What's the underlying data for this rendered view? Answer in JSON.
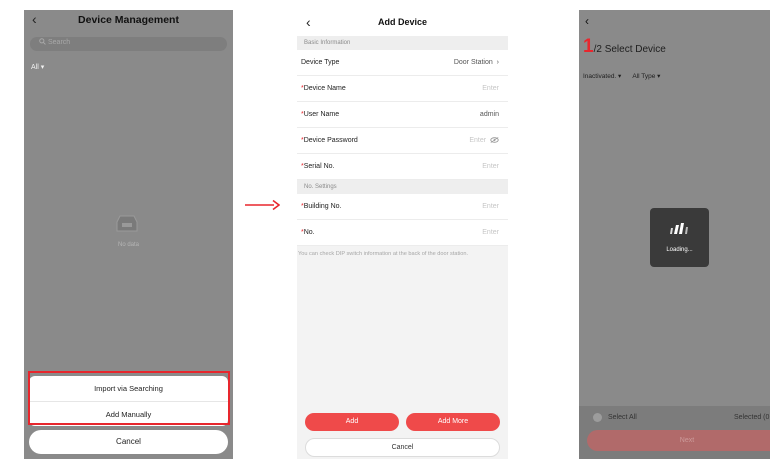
{
  "panel1": {
    "title": "Device Management",
    "search_placeholder": "Search",
    "filter": "All ▾",
    "empty_text": "No data",
    "sheet": {
      "option1": "Import via Searching",
      "option2": "Add Manually",
      "cancel": "Cancel"
    }
  },
  "panel2": {
    "title": "Add Device",
    "basic_section": "Basic Information",
    "rows": {
      "device_type": {
        "label": "Device Type",
        "value": "Door Station"
      },
      "device_name": {
        "label": "Device Name",
        "value": "Enter"
      },
      "user_name": {
        "label": "User Name",
        "value": "admin"
      },
      "device_password": {
        "label": "Device Password",
        "value": "Enter"
      },
      "serial_no": {
        "label": "Serial No.",
        "value": "Enter"
      },
      "building_no": {
        "label": "Building No.",
        "value": "Enter"
      },
      "no": {
        "label": "No.",
        "value": "Enter"
      }
    },
    "no_section": "No. Settings",
    "note": "You can check DIP switch information at the back of the door station.",
    "buttons": {
      "add": "Add",
      "add_more": "Add More",
      "cancel": "Cancel"
    }
  },
  "panel3": {
    "step_num": "1",
    "step_text": "/2 Select Device",
    "filter_status": "Inactivated. ▾",
    "filter_type": "All Type ▾",
    "loading": "Loading...",
    "select_all": "Select All",
    "selected": "Selected (0",
    "next": "Next"
  },
  "colors": {
    "accent_red": "#e8262d",
    "button_red": "#ef4a4a",
    "overlay_gray": "#8a8a8a"
  },
  "icons": [
    "back-chevron-icon",
    "search-icon",
    "empty-box-icon",
    "arrow-right-icon",
    "eye-off-icon",
    "loading-spinner-icon"
  ]
}
